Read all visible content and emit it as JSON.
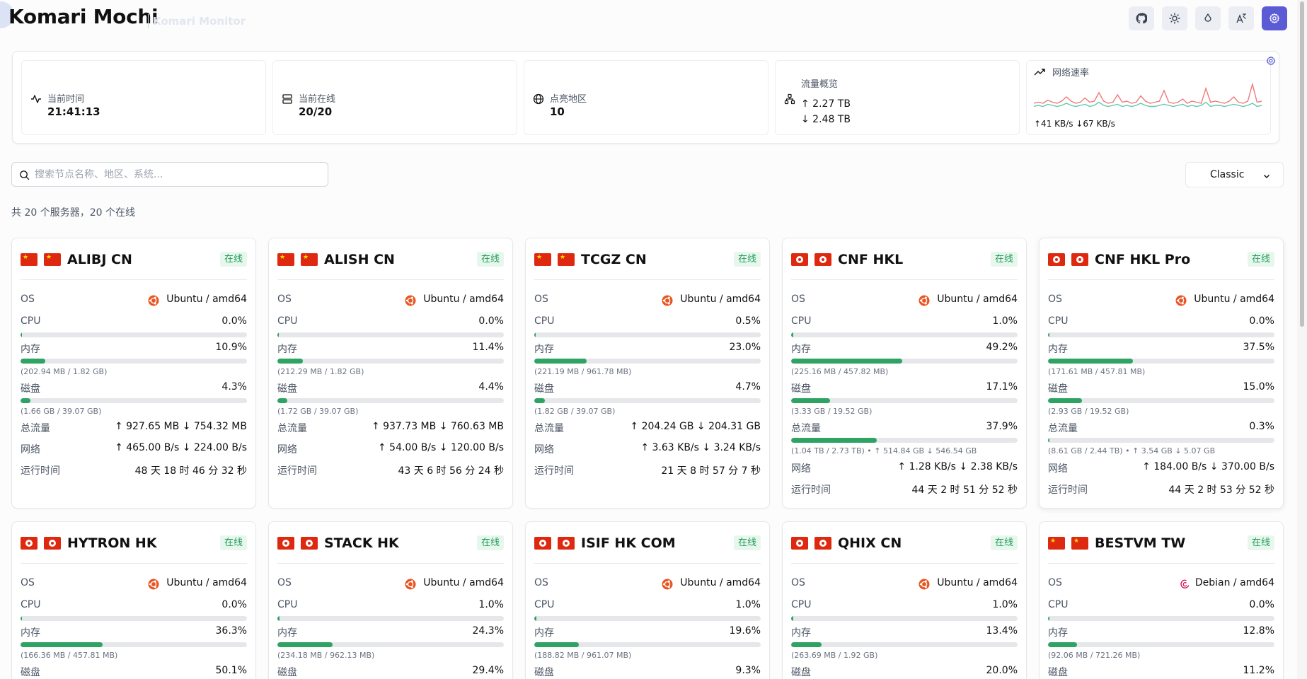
{
  "header": {
    "title": "Komari Mochi",
    "subtitle": "Komari Monitor",
    "buttons": [
      {
        "name": "github-icon"
      },
      {
        "name": "theme-toggle-icon"
      },
      {
        "name": "color-drop-icon"
      },
      {
        "name": "language-icon"
      },
      {
        "name": "settings-icon"
      }
    ],
    "accent_color": "#5b5bd6"
  },
  "stats": {
    "time": {
      "label": "当前时间",
      "value": "21:41:13"
    },
    "online": {
      "label": "当前在线",
      "value": "20/20"
    },
    "regions": {
      "label": "点亮地区",
      "value": "10"
    },
    "traffic": {
      "label": "流量概览",
      "up": "↑ 2.27 TB",
      "down": "↓ 2.48 TB"
    },
    "network": {
      "label": "网络速率",
      "speed": "↑41 KB/s   ↓67 KB/s",
      "up_series": [
        5,
        6,
        5,
        7,
        6,
        5,
        6,
        8,
        6,
        5,
        6,
        7,
        5,
        6,
        9,
        6,
        5,
        6,
        7,
        5,
        6,
        5,
        6,
        8,
        6,
        5,
        5,
        6,
        7,
        6,
        5,
        6,
        7,
        5,
        6,
        5,
        6,
        9,
        5,
        6,
        6,
        5,
        6,
        7,
        6,
        5,
        6,
        8,
        5,
        6
      ],
      "down_series": [
        8,
        9,
        8,
        11,
        9,
        8,
        10,
        14,
        10,
        8,
        9,
        13,
        9,
        10,
        18,
        10,
        8,
        9,
        16,
        9,
        10,
        8,
        9,
        15,
        10,
        8,
        9,
        10,
        20,
        9,
        8,
        9,
        12,
        8,
        10,
        9,
        8,
        22,
        9,
        10,
        9,
        8,
        10,
        14,
        9,
        8,
        10,
        26,
        9,
        10
      ]
    }
  },
  "search": {
    "placeholder": "搜索节点名称、地区、系统..."
  },
  "view_select": {
    "value": "Classic"
  },
  "summary": "共 20 个服务器，20 个在线",
  "labels": {
    "os": "OS",
    "cpu": "CPU",
    "mem": "内存",
    "disk": "磁盘",
    "traffic": "总流量",
    "net": "网络",
    "uptime": "运行时间",
    "online": "在线"
  },
  "servers": [
    {
      "name": "ALIBJ CN",
      "flag": "CN",
      "os": "Ubuntu / amd64",
      "cpu": "0.0%",
      "cpu_pct": 0.0,
      "mem": "10.9%",
      "mem_pct": 10.9,
      "mem_detail": "(202.94 MB / 1.82 GB)",
      "disk": "4.3%",
      "disk_pct": 4.3,
      "disk_detail": "(1.66 GB / 39.07 GB)",
      "traffic": "↑ 927.65 MB ↓ 754.32 MB",
      "net": "↑ 465.00 B/s ↓ 224.00 B/s",
      "uptime": "48 天 18 时 46 分 32 秒"
    },
    {
      "name": "ALISH CN",
      "flag": "CN",
      "os": "Ubuntu / amd64",
      "cpu": "0.0%",
      "cpu_pct": 0.0,
      "mem": "11.4%",
      "mem_pct": 11.4,
      "mem_detail": "(212.29 MB / 1.82 GB)",
      "disk": "4.4%",
      "disk_pct": 4.4,
      "disk_detail": "(1.72 GB / 39.07 GB)",
      "traffic": "↑ 937.73 MB ↓ 760.63 MB",
      "net": "↑ 54.00 B/s ↓ 120.00 B/s",
      "uptime": "43 天 6 时 56 分 24 秒"
    },
    {
      "name": "TCGZ CN",
      "flag": "CN",
      "os": "Ubuntu / amd64",
      "cpu": "0.5%",
      "cpu_pct": 0.5,
      "mem": "23.0%",
      "mem_pct": 23.0,
      "mem_detail": "(221.19 MB / 961.78 MB)",
      "disk": "4.7%",
      "disk_pct": 4.7,
      "disk_detail": "(1.82 GB / 39.07 GB)",
      "traffic": "↑ 204.24 GB ↓ 204.31 GB",
      "net": "↑ 3.63 KB/s ↓ 3.24 KB/s",
      "uptime": "21 天 8 时 57 分 7 秒"
    },
    {
      "name": "CNF HKL",
      "flag": "HK",
      "os": "Ubuntu / amd64",
      "cpu": "1.0%",
      "cpu_pct": 1.0,
      "mem": "49.2%",
      "mem_pct": 49.2,
      "mem_detail": "(225.16 MB / 457.82 MB)",
      "disk": "17.1%",
      "disk_pct": 17.1,
      "disk_detail": "(3.33 GB / 19.52 GB)",
      "traffic_pct_label": "37.9%",
      "traffic_pct": 37.9,
      "traffic_detail": "(1.04 TB / 2.73 TB) • ↑ 514.84 GB ↓ 546.54 GB",
      "net": "↑ 1.28 KB/s ↓ 2.38 KB/s",
      "uptime": "44 天 2 时 51 分 52 秒"
    },
    {
      "name": "CNF HKL Pro",
      "flag": "HK",
      "os": "Ubuntu / amd64",
      "cpu": "0.0%",
      "cpu_pct": 0.0,
      "mem": "37.5%",
      "mem_pct": 37.5,
      "mem_detail": "(171.61 MB / 457.81 MB)",
      "disk": "15.0%",
      "disk_pct": 15.0,
      "disk_detail": "(2.93 GB / 19.52 GB)",
      "traffic_pct_label": "0.3%",
      "traffic_pct": 0.3,
      "traffic_detail": "(8.61 GB / 2.44 TB) • ↑ 3.54 GB ↓ 5.07 GB",
      "net": "↑ 184.00 B/s ↓ 370.00 B/s",
      "uptime": "44 天 2 时 53 分 52 秒"
    },
    {
      "name": "HYTRON HK",
      "flag": "HK",
      "os": "Ubuntu / amd64",
      "cpu": "0.0%",
      "cpu_pct": 0.0,
      "mem": "36.3%",
      "mem_pct": 36.3,
      "mem_detail": "(166.36 MB / 457.81 MB)",
      "disk": "50.1%",
      "disk_pct": 50.1
    },
    {
      "name": "STACK HK",
      "flag": "HK",
      "os": "Ubuntu / amd64",
      "cpu": "1.0%",
      "cpu_pct": 1.0,
      "mem": "24.3%",
      "mem_pct": 24.3,
      "mem_detail": "(234.18 MB / 962.13 MB)",
      "disk": "29.4%",
      "disk_pct": 29.4
    },
    {
      "name": "ISIF HK COM",
      "flag": "HK",
      "os": "Ubuntu / amd64",
      "cpu": "1.0%",
      "cpu_pct": 1.0,
      "mem": "19.6%",
      "mem_pct": 19.6,
      "mem_detail": "(188.82 MB / 961.07 MB)",
      "disk": "9.3%",
      "disk_pct": 9.3
    },
    {
      "name": "QHIX CN",
      "flag": "HK",
      "os": "Ubuntu / amd64",
      "cpu": "1.0%",
      "cpu_pct": 1.0,
      "mem": "13.4%",
      "mem_pct": 13.4,
      "mem_detail": "(263.69 MB / 1.92 GB)",
      "disk": "20.0%",
      "disk_pct": 20.0
    },
    {
      "name": "BESTVM TW",
      "flag": "CN",
      "os": "Debian / amd64",
      "os_icon": "debian",
      "cpu": "0.0%",
      "cpu_pct": 0.0,
      "mem": "12.8%",
      "mem_pct": 12.8,
      "mem_detail": "(92.06 MB / 721.26 MB)",
      "disk": "11.2%",
      "disk_pct": 11.2
    }
  ]
}
